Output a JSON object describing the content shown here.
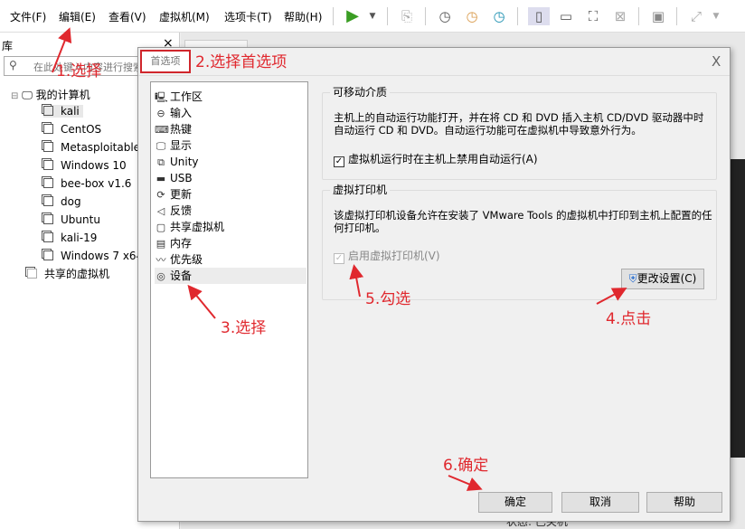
{
  "menubar": {
    "items": [
      "文件(F)",
      "编辑(E)",
      "查看(V)",
      "虚拟机(M)",
      "选项卡(T)",
      "帮助(H)"
    ]
  },
  "library": {
    "title": "库",
    "close": "×",
    "search_placeholder": "在此处键入内容进行搜索",
    "root": "我的计算机",
    "vms": [
      "kali",
      "CentOS",
      "Metasploitable",
      "Windows 10",
      "bee-box v1.6",
      "dog",
      "Ubuntu",
      "kali-19",
      "Windows 7 x64"
    ],
    "shared": "共享的虚拟机"
  },
  "status": "状态: 已关机",
  "dialog": {
    "title": "首选项",
    "close": "X",
    "categories": [
      {
        "icon": "monitor-icon",
        "label": "工作区"
      },
      {
        "icon": "mouse-icon",
        "label": "输入"
      },
      {
        "icon": "keyboard-icon",
        "label": "热键"
      },
      {
        "icon": "display-icon",
        "label": "显示"
      },
      {
        "icon": "unity-icon",
        "label": "Unity"
      },
      {
        "icon": "usb-icon",
        "label": "USB"
      },
      {
        "icon": "refresh-icon",
        "label": "更新"
      },
      {
        "icon": "feedback-icon",
        "label": "反馈"
      },
      {
        "icon": "shared-vm-icon",
        "label": "共享虚拟机"
      },
      {
        "icon": "memory-icon",
        "label": "内存"
      },
      {
        "icon": "priority-icon",
        "label": "优先级"
      },
      {
        "icon": "device-icon",
        "label": "设备"
      }
    ],
    "selected_category": "设备",
    "removable": {
      "title": "可移动介质",
      "desc": "主机上的自动运行功能打开，并在将 CD 和 DVD 插入主机 CD/DVD 驱动器中时自动运行 CD 和 DVD。自动运行功能可在虚拟机中导致意外行为。",
      "checkbox": "虚拟机运行时在主机上禁用自动运行(A)",
      "checked": true
    },
    "printer": {
      "title": "虚拟打印机",
      "desc": "该虚拟打印机设备允许在安装了 VMware Tools 的虚拟机中打印到主机上配置的任何打印机。",
      "checkbox": "启用虚拟打印机(V)",
      "checked": true,
      "disabled": true,
      "change_button": "更改设置(C)"
    },
    "buttons": {
      "ok": "确定",
      "cancel": "取消",
      "help": "帮助"
    }
  },
  "annotations": [
    "1.选择",
    "2.选择首选项",
    "3.选择",
    "4.点击",
    "5.勾选",
    "6.确定"
  ],
  "colors": {
    "annotation": "#e0282e",
    "play": "#3a9d23"
  }
}
